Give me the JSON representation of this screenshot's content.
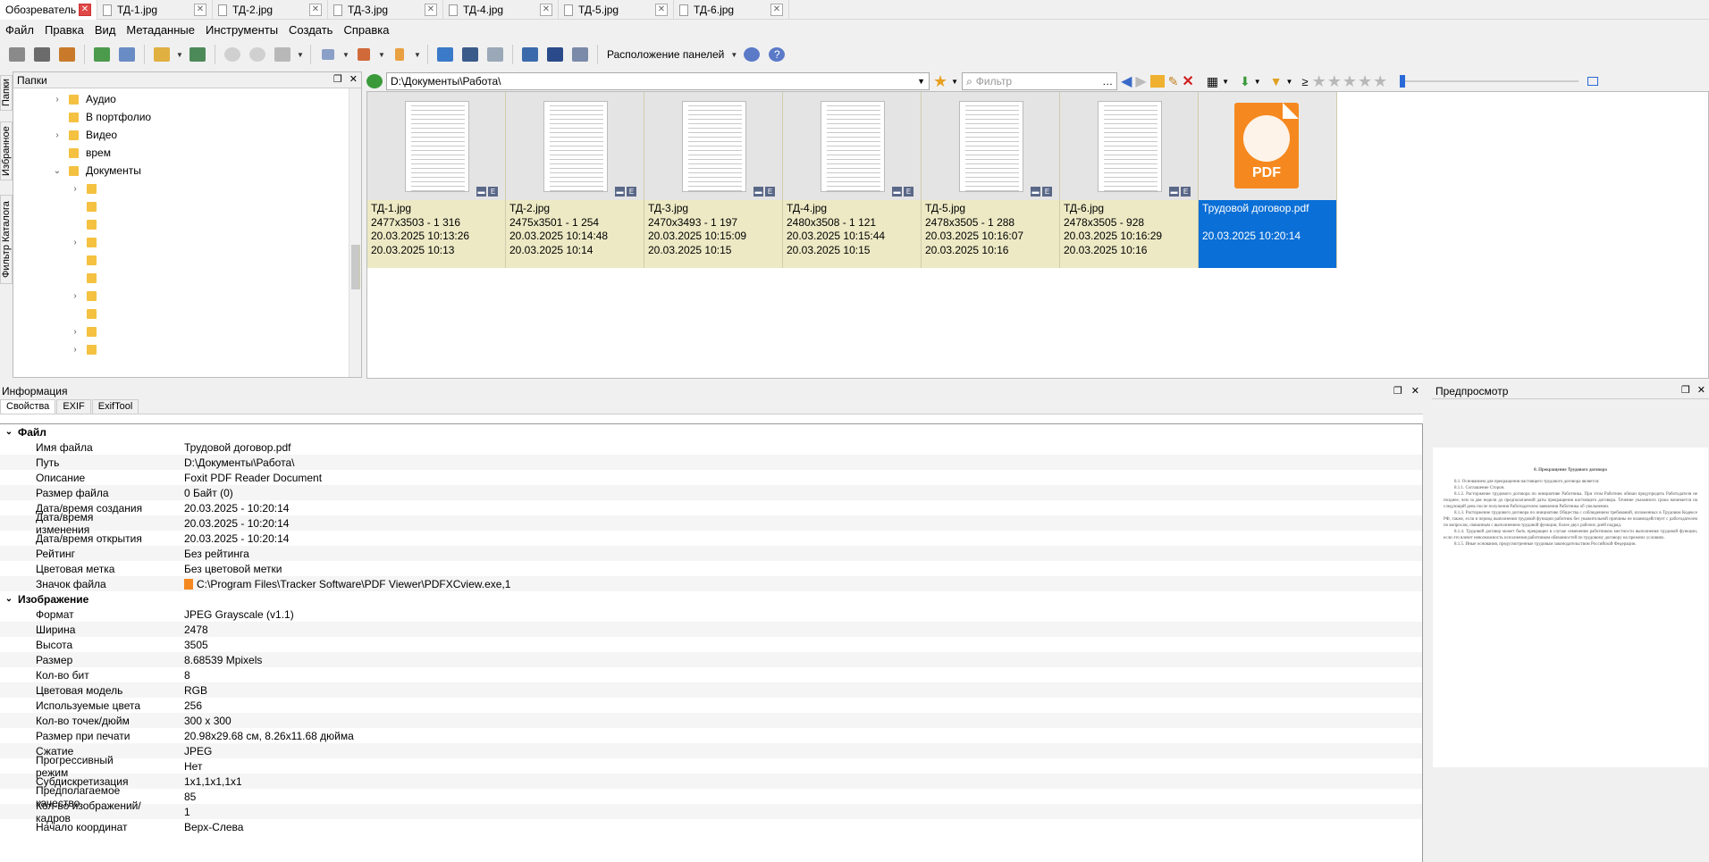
{
  "tabs": [
    {
      "label": "Обозреватель",
      "active": true
    },
    {
      "label": "ТД-1.jpg"
    },
    {
      "label": "ТД-2.jpg"
    },
    {
      "label": "ТД-3.jpg"
    },
    {
      "label": "ТД-4.jpg"
    },
    {
      "label": "ТД-5.jpg"
    },
    {
      "label": "ТД-6.jpg"
    }
  ],
  "menu": [
    "Файл",
    "Правка",
    "Вид",
    "Метаданные",
    "Инструменты",
    "Создать",
    "Справка"
  ],
  "toolbar": {
    "layout_label": "Расположение панелей"
  },
  "vtabs": [
    "Папки",
    "Избранное",
    "Фильтр Каталога"
  ],
  "folders": {
    "title": "Папки",
    "items": [
      {
        "label": "Аудио",
        "expandable": true
      },
      {
        "label": "В портфолио",
        "expandable": false
      },
      {
        "label": "Видео",
        "expandable": true
      },
      {
        "label": "врем",
        "expandable": false
      },
      {
        "label": "Документы",
        "expanded": true
      }
    ]
  },
  "address": {
    "path": "D:\\Документы\\Работа\\",
    "filter_placeholder": "Фильтр",
    "ge": "≥"
  },
  "thumbs": [
    {
      "name": "ТД-1.jpg",
      "l2": "2477x3503 - 1 316",
      "l3": "20.03.2025 10:13:26",
      "l4": "20.03.2025 10:13"
    },
    {
      "name": "ТД-2.jpg",
      "l2": "2475x3501 - 1 254",
      "l3": "20.03.2025 10:14:48",
      "l4": "20.03.2025 10:14"
    },
    {
      "name": "ТД-3.jpg",
      "l2": "2470x3493 - 1 197",
      "l3": "20.03.2025 10:15:09",
      "l4": "20.03.2025 10:15"
    },
    {
      "name": "ТД-4.jpg",
      "l2": "2480x3508 - 1 121",
      "l3": "20.03.2025 10:15:44",
      "l4": "20.03.2025 10:15"
    },
    {
      "name": "ТД-5.jpg",
      "l2": "2478x3505 - 1 288",
      "l3": "20.03.2025 10:16:07",
      "l4": "20.03.2025 10:16"
    },
    {
      "name": "ТД-6.jpg",
      "l2": "2478x3505 - 928",
      "l3": "20.03.2025 10:16:29",
      "l4": "20.03.2025 10:16"
    },
    {
      "name": "Трудовой договор.pdf",
      "l2": "",
      "l3": "20.03.2025 10:20:14",
      "l4": "",
      "selected": true,
      "icon_text": "PDF"
    }
  ],
  "info": {
    "title": "Информация",
    "tabs": [
      "Свойства",
      "EXIF",
      "ExifTool"
    ],
    "groups": [
      {
        "title": "Файл",
        "rows": [
          {
            "k": "Имя файла",
            "v": "Трудовой договор.pdf"
          },
          {
            "k": "Путь",
            "v": "D:\\Документы\\Работа\\"
          },
          {
            "k": "Описание",
            "v": "Foxit PDF Reader Document"
          },
          {
            "k": "Размер файла",
            "v": "0 Байт (0)"
          },
          {
            "k": "Дата/время создания",
            "v": "20.03.2025 - 10:20:14"
          },
          {
            "k": "Дата/время изменения",
            "v": "20.03.2025 - 10:20:14"
          },
          {
            "k": "Дата/время открытия",
            "v": "20.03.2025 - 10:20:14"
          },
          {
            "k": "Рейтинг",
            "v": "Без рейтинга"
          },
          {
            "k": "Цветовая метка",
            "v": "Без цветовой метки"
          },
          {
            "k": "Значок файла",
            "v": "C:\\Program Files\\Tracker Software\\PDF Viewer\\PDFXCview.exe,1"
          }
        ]
      },
      {
        "title": "Изображение",
        "rows": [
          {
            "k": "Формат",
            "v": "JPEG Grayscale (v1.1)"
          },
          {
            "k": "Ширина",
            "v": "2478"
          },
          {
            "k": "Высота",
            "v": "3505"
          },
          {
            "k": "Размер",
            "v": "8.68539 Mpixels"
          },
          {
            "k": "Кол-во бит",
            "v": "8"
          },
          {
            "k": "Цветовая модель",
            "v": "RGB"
          },
          {
            "k": "Используемые цвета",
            "v": "256"
          },
          {
            "k": "Кол-во точек/дюйм",
            "v": "300 x 300"
          },
          {
            "k": "Размер при печати",
            "v": "20.98x29.68 см, 8.26x11.68 дюйма"
          },
          {
            "k": "Сжатие",
            "v": "JPEG"
          },
          {
            "k": "Прогрессивный режим",
            "v": "Нет"
          },
          {
            "k": "Субдискретизация",
            "v": "1x1,1x1,1x1"
          },
          {
            "k": "Предполагаемое качество",
            "v": "85"
          },
          {
            "k": "Кол-во изображений/кадров",
            "v": "1"
          },
          {
            "k": "Начало координат",
            "v": "Верх-Слева"
          }
        ]
      }
    ]
  },
  "preview": {
    "title": "Предпросмотр",
    "doc_heading": "8. Прекращение Трудового договора",
    "doc_lines": [
      "8.1. Основанием для прекращения настоящего трудового договора является:",
      "8.1.1. Соглашение Сторон.",
      "8.1.2. Расторжение трудового договора по инициативе Работника. При этом Работник обязан предупредить Работодателя не позднее, чем за две недели до предполагаемой даты прекращения настоящего договора. Течение указанного срока начинается на следующий день после получения Работодателем заявления Работника об увольнении.",
      "8.1.3. Расторжение трудового договора по инициативе Общества с соблюдением требований, изложенных в Трудовом Кодексе РФ, также, если в период выполнения трудовой функции работник без уважительной причины не взаимодействует с работодателем по вопросам, связанным с выполнением трудовой функции, более двух рабочих дней подряд.",
      "8.1.4. Трудовой договор может быть прекращен в случае изменения работником местности выполнения трудовой функции, если это влечет невозможность исполнения работником обязанностей по трудовому договору на прежних условиях.",
      "8.1.5. Иные основания, предусмотренные трудовым законодательством Российской Федерации."
    ]
  },
  "colors": {
    "selected": "#0a6fd6",
    "thumb_bg": "#ece9c4",
    "pdf_orange": "#f5891f",
    "folder": "#f4c141"
  }
}
